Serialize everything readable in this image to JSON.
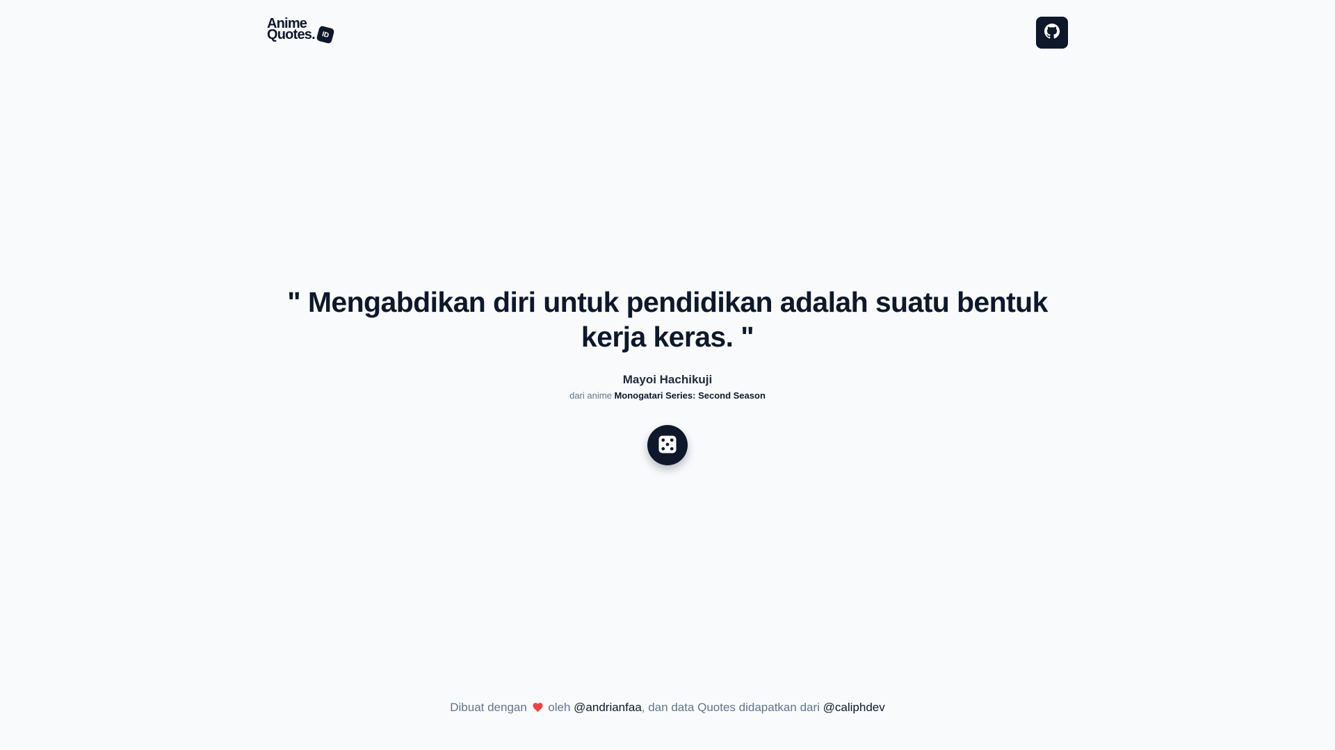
{
  "header": {
    "logo": {
      "line1": "Anime",
      "line2": "Quotes.",
      "badge": "ID"
    },
    "github_icon": "github-icon"
  },
  "main": {
    "quote": "\" Mengabdikan diri untuk pendidikan adalah suatu bentuk kerja keras. \"",
    "character": "Mayoi Hachikuji",
    "source_prefix": "dari anime",
    "anime": "Monogatari Series: Second Season",
    "random_button_icon": "dice-icon"
  },
  "footer": {
    "made_with": "Dibuat dengan",
    "heart_icon": "heart-icon",
    "by": "oleh",
    "author": "@andrianfaa",
    "data_text": ", dan data Quotes didapatkan dari",
    "data_source": "@caliphdev"
  },
  "colors": {
    "background": "#f8fafc",
    "primary": "#0f172a",
    "muted": "#64748b",
    "heart": "#ef4444"
  }
}
